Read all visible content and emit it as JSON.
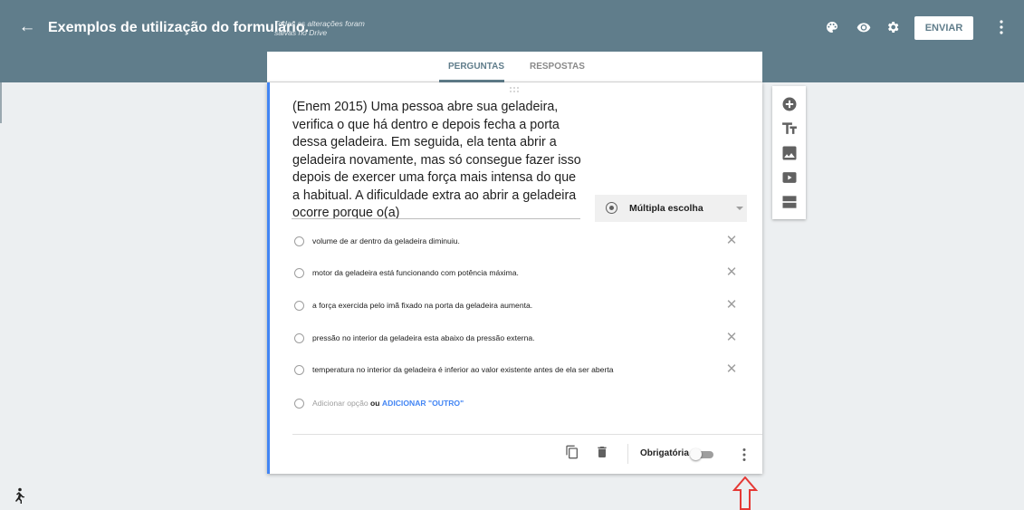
{
  "header": {
    "title": "Exemplos de utilização do formulário.",
    "save_status": "Todas as alterações foram salvas no Drive",
    "send_label": "ENVIAR",
    "icons": [
      "arrow-left-icon",
      "palette-icon",
      "eye-icon",
      "gear-icon",
      "more-vert-icon"
    ]
  },
  "tabs": [
    {
      "label": "PERGUNTAS",
      "active": true
    },
    {
      "label": "RESPOSTAS",
      "active": false
    }
  ],
  "question": {
    "text": "(Enem 2015) Uma pessoa abre sua geladeira, verifica o que há dentro e depois fecha a porta dessa geladeira. Em seguida, ela tenta abrir a geladeira novamente, mas só consegue fazer isso depois de exercer uma força mais intensa do que a habitual. A dificuldade extra ao abrir a geladeira ocorre porque o(a)",
    "type_label": "Múltipla escolha",
    "options": [
      "volume de ar dentro da geladeira diminuiu.",
      "motor da geladeira está funcionando com potência máxima.",
      "a força exercida pelo imã fixado na porta da geladeira aumenta.",
      "pressão no interior da geladeira esta abaixo da pressão externa.",
      "temperatura no interior da geladeira é inferior ao valor existente antes de ela ser aberta"
    ],
    "add_option": "Adicionar opção",
    "or_label": "ou",
    "add_other": "ADICIONAR \"OUTRO\"",
    "required_label": "Obrigatória",
    "required": false
  },
  "side_toolbar": [
    "add-circle-icon",
    "text-format-icon",
    "image-icon",
    "video-icon",
    "section-icon"
  ],
  "colors": {
    "header": "#607d8b",
    "background": "#eceff1",
    "accent": "#4285f4",
    "annotation_arrow": "#e53935"
  }
}
